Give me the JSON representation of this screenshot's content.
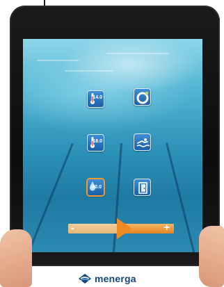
{
  "screen": {
    "tiles": [
      {
        "id": "water-temp",
        "value": "14.0",
        "sub": "",
        "active": false
      },
      {
        "id": "pool-cover",
        "value": "",
        "sub": "",
        "active": false
      },
      {
        "id": "air-temp",
        "value": "18.0",
        "sub": "",
        "active": false
      },
      {
        "id": "swimmer",
        "value": "",
        "sub": "",
        "active": false
      },
      {
        "id": "humidity",
        "value": "40.0",
        "sub": "",
        "active": true
      },
      {
        "id": "door",
        "value": "",
        "sub": "",
        "active": false
      }
    ],
    "slider": {
      "minus_label": "-",
      "plus_label": "+",
      "level": 0.5
    }
  },
  "brand": {
    "name": "menerga"
  },
  "colors": {
    "tile_blue": "#1b5fa8",
    "active_border": "#f39a33",
    "slider_orange": "#e78521",
    "brand_blue": "#16467e"
  }
}
